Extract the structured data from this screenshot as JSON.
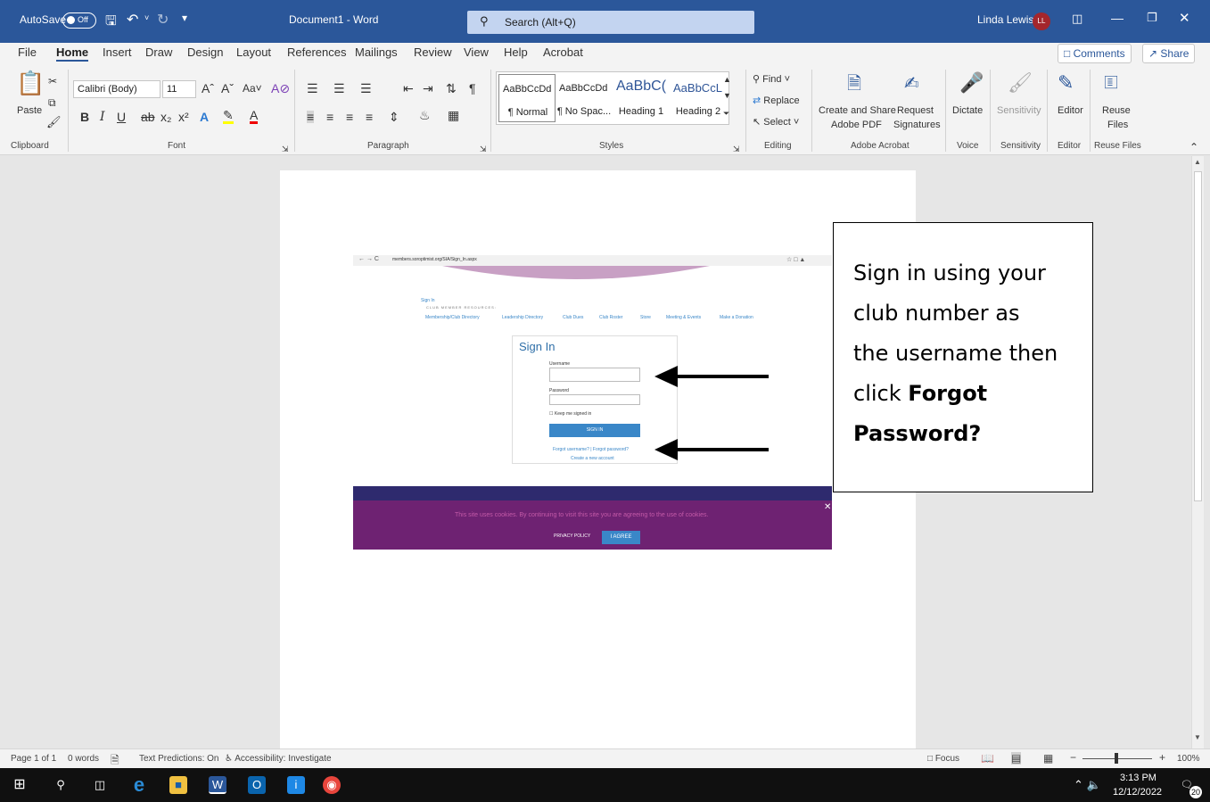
{
  "titlebar": {
    "autosave_label": "AutoSave",
    "autosave_state": "Off",
    "doc_title": "Document1  -  Word",
    "search_placeholder": "Search (Alt+Q)",
    "user_name": "Linda Lewis",
    "user_initials": "LL"
  },
  "menu": {
    "items": [
      "File",
      "Home",
      "Insert",
      "Draw",
      "Design",
      "Layout",
      "References",
      "Mailings",
      "Review",
      "View",
      "Help",
      "Acrobat"
    ],
    "active": "Home",
    "comments_label": "Comments",
    "share_label": "Share"
  },
  "ribbon": {
    "clipboard": {
      "paste": "Paste",
      "group": "Clipboard"
    },
    "font": {
      "name": "Calibri (Body)",
      "size": "11",
      "group": "Font"
    },
    "paragraph": {
      "group": "Paragraph"
    },
    "styles": {
      "items": [
        {
          "preview": "AaBbCcDd",
          "name": "¶ Normal"
        },
        {
          "preview": "AaBbCcDd",
          "name": "¶ No Spac..."
        },
        {
          "preview": "AaBbC(",
          "name": "Heading 1"
        },
        {
          "preview": "AaBbCcL",
          "name": "Heading 2"
        }
      ],
      "group": "Styles"
    },
    "editing": {
      "find": "Find",
      "replace": "Replace",
      "select": "Select",
      "group": "Editing"
    },
    "acrobat": {
      "create": "Create and Share",
      "create2": "Adobe PDF",
      "request": "Request",
      "request2": "Signatures",
      "group": "Adobe Acrobat"
    },
    "voice": {
      "dictate": "Dictate",
      "group": "Voice"
    },
    "sensitivity": {
      "label": "Sensitivity",
      "group": "Sensitivity"
    },
    "editor": {
      "label": "Editor",
      "group": "Editor"
    },
    "reuse": {
      "label": "Reuse",
      "label2": "Files",
      "group": "Reuse Files"
    }
  },
  "embedded_screenshot": {
    "url": "members.soroptimist.org/SIA/Sign_In.aspx",
    "breadcrumb": "Sign In",
    "section": "CLUB MEMBER RESOURCES:",
    "nav": [
      "Membership/Club Directory",
      "Leadership Directory",
      "Club Dues",
      "Club Roster",
      "Store",
      "Meeting & Events",
      "Make a Donation"
    ],
    "form_title": "Sign In",
    "username_label": "Username",
    "password_label": "Password",
    "keep_signed": "Keep me signed in",
    "sign_in_button": "SIGN IN",
    "forgot_links": "Forgot username? | Forgot password?",
    "create_account": "Create a new account",
    "cookie_text": "This site uses cookies. By continuing to visit this site you are agreeing to the use of cookies.",
    "privacy_policy": "PRIVACY POLICY",
    "agree": "I AGREE"
  },
  "callout": {
    "line1": "Sign in using your",
    "line2": "club number as",
    "line3": "the username then",
    "line4_prefix": "click ",
    "line4_bold": "Forgot",
    "line5_bold": "Password?"
  },
  "statusbar": {
    "page": "Page 1 of 1",
    "words": "0 words",
    "predictions": "Text Predictions: On",
    "accessibility": "Accessibility: Investigate",
    "focus": "Focus",
    "zoom": "100%"
  },
  "taskbar": {
    "time": "3:13 PM",
    "date": "12/12/2022",
    "notifications": "20"
  },
  "colors": {
    "word_blue": "#2b579a",
    "cookie_purple": "#6e2272",
    "agree_blue": "#3a87c8",
    "avatar_red": "#a4262c"
  }
}
